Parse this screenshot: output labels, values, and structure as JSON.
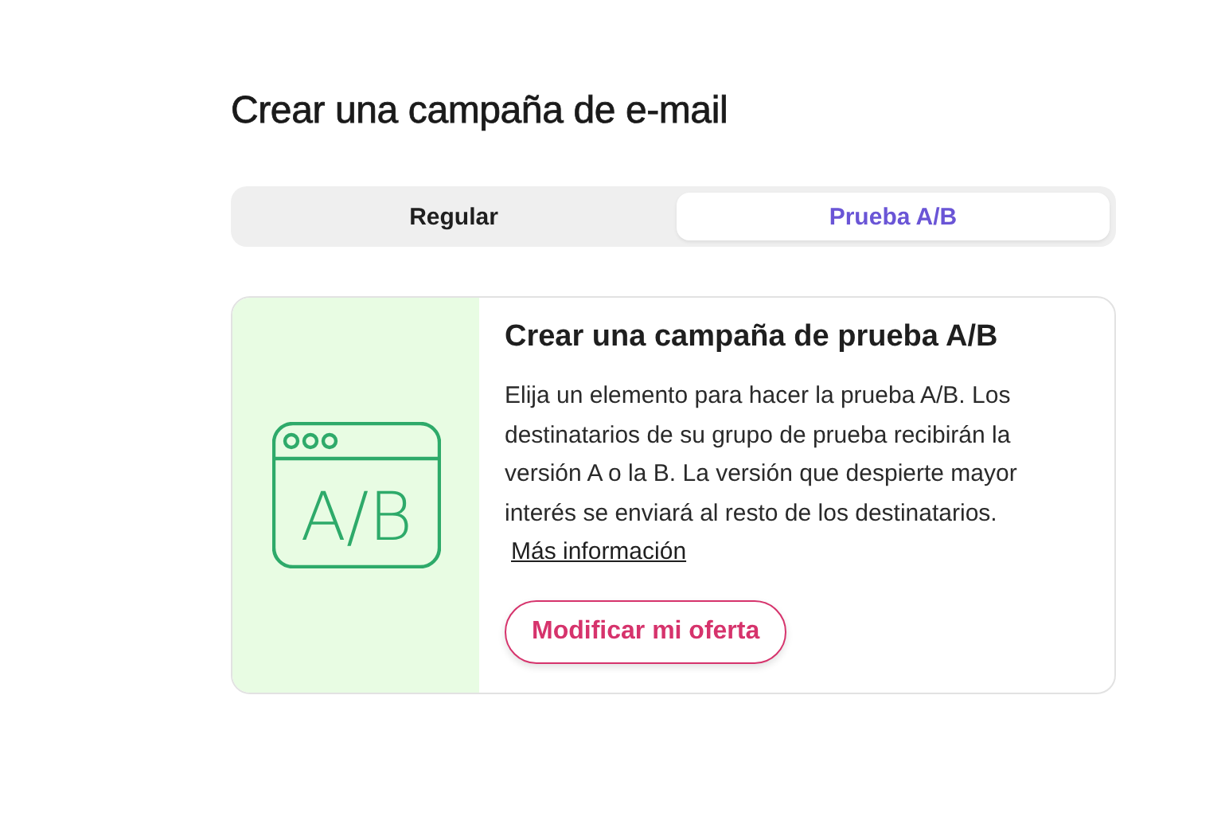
{
  "title": "Crear una campaña de e-mail",
  "tabs": [
    {
      "label": "Regular",
      "selected": false
    },
    {
      "label": "Prueba A/B",
      "selected": true
    }
  ],
  "card": {
    "illustration_text": "A/B",
    "heading": "Crear una campaña de prueba A/B",
    "description": "Elija un elemento para hacer la prueba A/B. Los destinatarios de su grupo de prueba recibirán la versión A o la B. La versión que despierte mayor interés se enviará al resto de los destinatarios.",
    "link": "Más información",
    "button": "Modificar mi oferta"
  }
}
